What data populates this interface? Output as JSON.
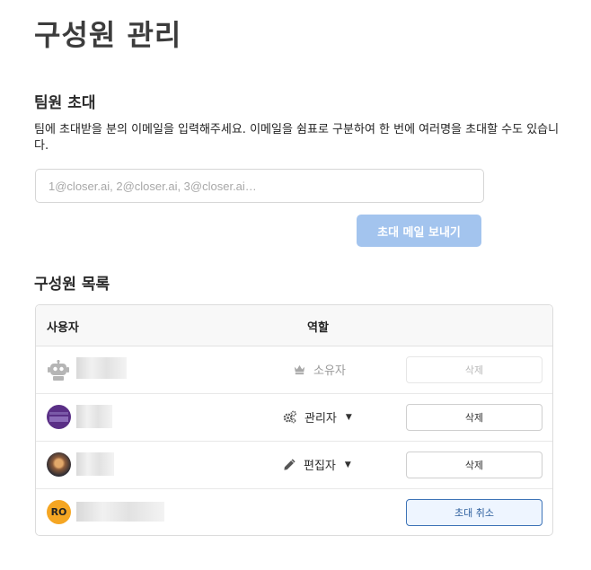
{
  "page_title": "구성원 관리",
  "invite": {
    "title": "팀원 초대",
    "description": "팀에 초대받을 분의 이메일을 입력해주세요. 이메일을 쉼표로 구분하여 한 번에 여러명을 초대할 수도 있습니다.",
    "email_value": "",
    "email_placeholder": "1@closer.ai, 2@closer.ai, 3@closer.ai…",
    "send_label": "초대 메일 보내기"
  },
  "members": {
    "title": "구성원 목록",
    "columns": {
      "user": "사용자",
      "role": "역할"
    },
    "rows": [
      {
        "avatar": "robot-icon",
        "role": "소유자",
        "role_icon": "crown-icon",
        "action": "삭제",
        "action_enabled": false
      },
      {
        "avatar": "purple-avatar",
        "role": "관리자",
        "role_icon": "gears-icon",
        "action": "삭제",
        "action_enabled": true
      },
      {
        "avatar": "photo-avatar",
        "role": "편집자",
        "role_icon": "pencil-icon",
        "action": "삭제",
        "action_enabled": true
      },
      {
        "avatar_initials": "RO",
        "role": "",
        "action": "초대 취소",
        "action_enabled": true
      }
    ]
  },
  "colors": {
    "primary_button_disabled": "#a3c4ee",
    "cancel_border": "#3d73b7",
    "initials_avatar": "#f5a623",
    "purple_avatar": "#5a2f86"
  }
}
